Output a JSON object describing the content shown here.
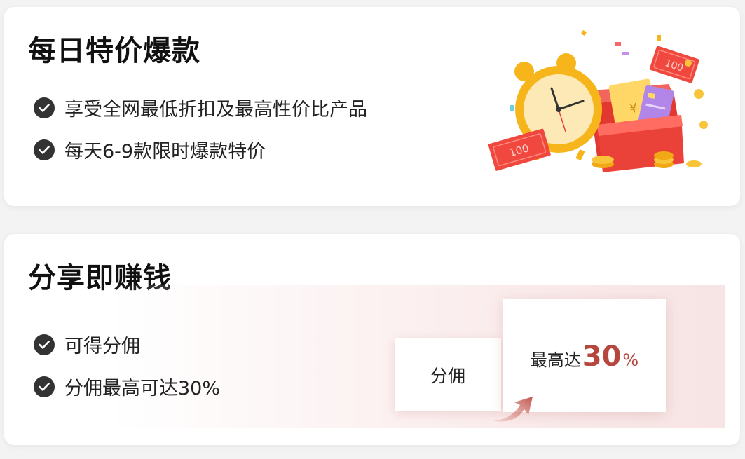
{
  "card1": {
    "title": "每日特价爆款",
    "features": [
      "享受全网最低折扣及最高性价比产品",
      "每天6-9款限时爆款特价"
    ],
    "illustration_labels": {
      "bill_left": "100",
      "bill_right": "100",
      "coin_symbol": "¥"
    }
  },
  "card2": {
    "title": "分享即赚钱",
    "features": [
      "可得分佣",
      "分佣最高可达30%"
    ],
    "compare": {
      "small_label": "分佣",
      "big_label": "最高达",
      "big_value": "30",
      "big_unit": "%"
    }
  },
  "colors": {
    "accent_red": "#b5473f",
    "check_bg": "#333333"
  }
}
